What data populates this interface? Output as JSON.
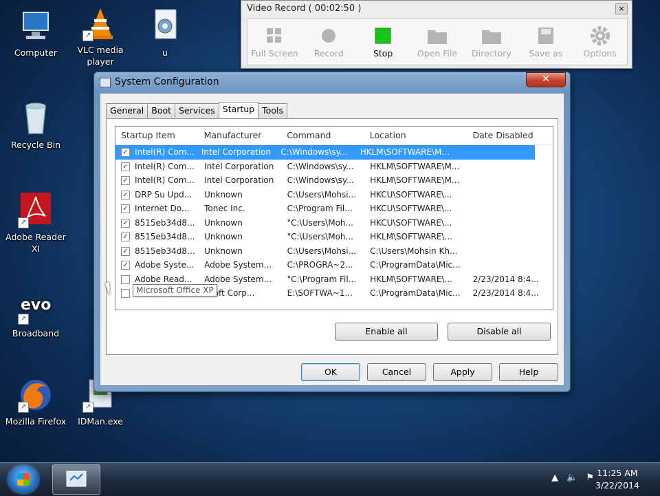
{
  "desktop_icons": [
    {
      "label": "Computer",
      "icon": "computer-icon"
    },
    {
      "label": "VLC media player",
      "icon": "vlc-icon"
    },
    {
      "label": "u",
      "icon": "gear-file-icon"
    },
    {
      "label": "Recycle Bin",
      "icon": "recycle-bin-icon"
    },
    {
      "label": "Adobe Reader XI",
      "icon": "adobe-reader-icon"
    },
    {
      "label": "Broadband",
      "icon": "evo-broadband-icon"
    },
    {
      "label": "Mozilla Firefox",
      "icon": "firefox-icon"
    },
    {
      "label": "IDMan.exe",
      "icon": "idman-icon"
    }
  ],
  "video_record": {
    "title": "Video Record   ( 00:02:50 )",
    "close_label": "×",
    "buttons": [
      {
        "label": "Full Screen",
        "icon": "grid-icon",
        "active": false
      },
      {
        "label": "Record",
        "icon": "record-dot-icon",
        "active": false
      },
      {
        "label": "Stop",
        "icon": "stop-square-icon",
        "active": true
      },
      {
        "label": "Open File",
        "icon": "folder-icon",
        "active": false
      },
      {
        "label": "Directory",
        "icon": "folder-icon",
        "active": false
      },
      {
        "label": "Save as",
        "icon": "save-icon",
        "active": false
      },
      {
        "label": "Options",
        "icon": "gear-icon",
        "active": false
      }
    ]
  },
  "system_config": {
    "title": "System Configuration",
    "close_label": "✕",
    "tabs": [
      "General",
      "Boot",
      "Services",
      "Startup",
      "Tools"
    ],
    "selected_tab": "Startup",
    "columns": [
      "Startup Item",
      "Manufacturer",
      "Command",
      "Location",
      "Date Disabled"
    ],
    "rows": [
      {
        "checked": true,
        "item": "Intel(R) Com...",
        "manufacturer": "Intel Corporation",
        "command": "C:\\Windows\\sy...",
        "location": "HKLM\\SOFTWARE\\M...",
        "date": ""
      },
      {
        "checked": true,
        "item": "Intel(R) Com...",
        "manufacturer": "Intel Corporation",
        "command": "C:\\Windows\\sy...",
        "location": "HKLM\\SOFTWARE\\M...",
        "date": ""
      },
      {
        "checked": true,
        "item": "Intel(R) Com...",
        "manufacturer": "Intel Corporation",
        "command": "C:\\Windows\\sy...",
        "location": "HKLM\\SOFTWARE\\M...",
        "date": ""
      },
      {
        "checked": true,
        "item": "DRP Su Upd...",
        "manufacturer": "Unknown",
        "command": "C:\\Users\\Mohsi...",
        "location": "HKCU\\SOFTWARE\\...",
        "date": ""
      },
      {
        "checked": true,
        "item": "Internet Do...",
        "manufacturer": "Tonec Inc.",
        "command": "C:\\Program Fil...",
        "location": "HKCU\\SOFTWARE\\...",
        "date": ""
      },
      {
        "checked": true,
        "item": "8515eb34d8...",
        "manufacturer": "Unknown",
        "command": "\"C:\\Users\\Moh...",
        "location": "HKCU\\SOFTWARE\\...",
        "date": ""
      },
      {
        "checked": true,
        "item": "8515eb34d8...",
        "manufacturer": "Unknown",
        "command": "\"C:\\Users\\Moh...",
        "location": "HKLM\\SOFTWARE\\...",
        "date": ""
      },
      {
        "checked": true,
        "item": "8515eb34d8...",
        "manufacturer": "Unknown",
        "command": "C:\\Users\\Mohsi...",
        "location": "C:\\Users\\Mohsin Kh...",
        "date": ""
      },
      {
        "checked": true,
        "item": "Adobe Syste...",
        "manufacturer": "Adobe System...",
        "command": "C:\\PROGRA~2...",
        "location": "C:\\ProgramData\\Mic...",
        "date": ""
      },
      {
        "checked": false,
        "item": "Adobe Read...",
        "manufacturer": "Adobe System...",
        "command": "\"C:\\Program Fil...",
        "location": "HKLM\\SOFTWARE\\...",
        "date": "2/23/2014 8:4..."
      },
      {
        "checked": false,
        "item": "Microsoft Office XP",
        "manufacturer": "osoft Corp...",
        "command": "E:\\SOFTWA~1...",
        "location": "C:\\ProgramData\\Mic...",
        "date": "2/23/2014 8:4..."
      }
    ],
    "tooltip": "Microsoft Office XP",
    "enable_all": "Enable all",
    "disable_all": "Disable all",
    "ok": "OK",
    "cancel": "Cancel",
    "apply": "Apply",
    "help": "Help"
  },
  "taskbar": {
    "clock_time": "11:25 AM",
    "clock_date": "3/22/2014",
    "tray_icons": [
      "show-hidden-arrow-icon",
      "speaker-icon",
      "flag-icon"
    ]
  }
}
